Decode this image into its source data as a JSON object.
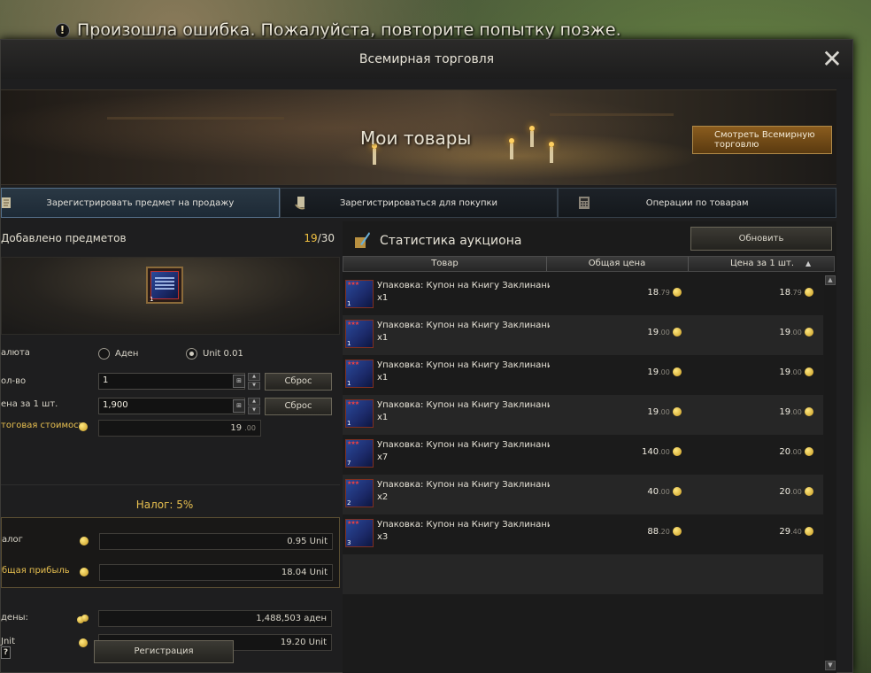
{
  "error_message": "Произошла ошибка. Пожалуйста, повторите попытку позже.",
  "window": {
    "title": "Всемирная торговля",
    "close_label": "✕"
  },
  "banner": {
    "title": "Мои товары",
    "view_world_button": "Смотреть Всемирную торговлю"
  },
  "tabs": [
    {
      "label": "Зарегистрировать предмет на продажу",
      "active": true,
      "icon": "scroll-icon"
    },
    {
      "label": "Зарегистрироваться для покупки",
      "active": false,
      "icon": "hand-scroll-icon"
    },
    {
      "label": "Операции по товарам",
      "active": false,
      "icon": "calculator-icon"
    }
  ],
  "left": {
    "added_label": "Добавлено предметов",
    "added_current": "19",
    "added_total": "/30",
    "slot_qty": "1",
    "currency_label": "алюта",
    "currency_options": [
      "Аден",
      "Unit 0.01"
    ],
    "currency_selected": "Unit 0.01",
    "qty_label": "ол-во",
    "qty_value": "1",
    "reset_label": "Сброс",
    "price_label": "ена за 1 шт.",
    "price_value": "1,900",
    "total_label": "тоговая стоимост",
    "total_value": "19",
    "total_dec": ".00",
    "tax_title": "Налог: 5%",
    "tax_label": "алог",
    "tax_value": "0.95 Unit",
    "profit_label": "бщая прибыль",
    "profit_value": "18.04 Unit",
    "adena_label": "дены:",
    "adena_value": "1,488,503 аден",
    "unit_label": "Jnit",
    "unit_value": "19.20 Unit",
    "help_label": "?",
    "register_button": "Регистрация"
  },
  "right": {
    "title": "Статистика аукциона",
    "refresh_button": "Обновить",
    "columns": [
      "Товар",
      "Общая цена",
      "Цена за 1 шт."
    ],
    "sort_indicator": "▲",
    "rows": [
      {
        "name": "Упаковка: Купон на Книгу Заклинаний",
        "count": "x1",
        "qty": "1",
        "total": "18",
        "total_dec": ".79",
        "unit": "18",
        "unit_dec": ".79"
      },
      {
        "name": "Упаковка: Купон на Книгу Заклинаний",
        "count": "x1",
        "qty": "1",
        "total": "19",
        "total_dec": ".00",
        "unit": "19",
        "unit_dec": ".00"
      },
      {
        "name": "Упаковка: Купон на Книгу Заклинаний",
        "count": "x1",
        "qty": "1",
        "total": "19",
        "total_dec": ".00",
        "unit": "19",
        "unit_dec": ".00"
      },
      {
        "name": "Упаковка: Купон на Книгу Заклинаний",
        "count": "x1",
        "qty": "1",
        "total": "19",
        "total_dec": ".00",
        "unit": "19",
        "unit_dec": ".00"
      },
      {
        "name": "Упаковка: Купон на Книгу Заклинаний",
        "count": "x7",
        "qty": "7",
        "total": "140",
        "total_dec": ".00",
        "unit": "20",
        "unit_dec": ".00"
      },
      {
        "name": "Упаковка: Купон на Книгу Заклинаний",
        "count": "x2",
        "qty": "2",
        "total": "40",
        "total_dec": ".00",
        "unit": "20",
        "unit_dec": ".00"
      },
      {
        "name": "Упаковка: Купон на Книгу Заклинаний",
        "count": "x3",
        "qty": "3",
        "total": "88",
        "total_dec": ".20",
        "unit": "29",
        "unit_dec": ".40"
      }
    ]
  }
}
